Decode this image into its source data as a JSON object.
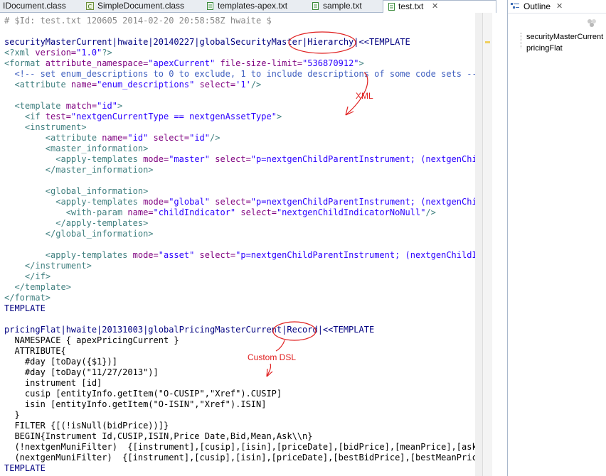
{
  "tabs": [
    {
      "label": "IDocument.class",
      "icon": "class-file-icon"
    },
    {
      "label": "SimpleDocument.class",
      "icon": "class-file-icon"
    },
    {
      "label": "templates-apex.txt",
      "icon": "text-file-icon"
    },
    {
      "label": "sample.txt",
      "icon": "text-file-icon"
    },
    {
      "label": "test.txt",
      "icon": "text-file-icon",
      "active": true,
      "close": "✕"
    }
  ],
  "editor": {
    "lines": [
      "# $Id: test.txt 120605 2014-02-20 20:58:58Z hwaite $",
      "",
      "securityMasterCurrent|hwaite|20140227|globalSecurityMaster|Hierarchy|<<TEMPLATE",
      "<?xml version=\"1.0\"?>",
      "<format attribute_namespace=\"apexCurrent\" file-size-limit=\"536870912\">",
      "  <!-- set enum_descriptions to 0 to exclude, 1 to include descriptions of some code sets -->",
      "  <attribute name=\"enum_descriptions\" select='1'/>",
      "",
      "  <template match=\"id\">",
      "    <if test=\"nextgenCurrentType == nextgenAssetType\">",
      "    <instrument>",
      "        <attribute name=\"id\" select=\"id\"/>",
      "        <master_information>",
      "          <apply-templates mode=\"master\" select=\"p=nextgenChildParentInstrument; (nextgenChild",
      "        </master_information>",
      "",
      "        <global_information>",
      "          <apply-templates mode=\"global\" select=\"p=nextgenChildParentInstrument; (nextgenChild",
      "            <with-param name=\"childIndicator\" select=\"nextgenChildIndicatorNoNull\"/>",
      "          </apply-templates>",
      "        </global_information>",
      "",
      "        <apply-templates mode=\"asset\" select=\"p=nextgenChildParentInstrument; (nextgenChildInd",
      "    </instrument>",
      "    </if>",
      "  </template>",
      "</format>",
      "TEMPLATE",
      "",
      "pricingFlat|hwaite|20131003|globalPricingMasterCurrent|Record|<<TEMPLATE",
      "  NAMESPACE { apexPricingCurrent }",
      "  ATTRIBUTE{",
      "    #day [toDay({$1})]",
      "    #day [toDay(\"11/27/2013\")]",
      "    instrument [id]",
      "    cusip [entityInfo.getItem(\"O-CUSIP\",\"Xref\").CUSIP]",
      "    isin [entityInfo.getItem(\"O-ISIN\",\"Xref\").ISIN]",
      "  }",
      "  FILTER {[(!isNull(bidPrice))]}",
      "  BEGIN{Instrument Id,CUSIP,ISIN,Price Date,Bid,Mean,Ask\\\\n}",
      "  (!nextgenMuniFilter)  {[instrument],[cusip],[isin],[priceDate],[bidPrice],[meanPrice],[askPr",
      "  (nextgenMuniFilter)  {[instrument],[cusip],[isin],[priceDate],[bestBidPrice],[bestMeanPrice]",
      "TEMPLATE"
    ]
  },
  "annotations": {
    "xml_label": "XML",
    "dsl_label": "Custom DSL",
    "color": "#e02020"
  },
  "outline": {
    "title": "Outline",
    "close": "✕",
    "items": [
      "securityMasterCurrent",
      "pricingFlat"
    ]
  }
}
